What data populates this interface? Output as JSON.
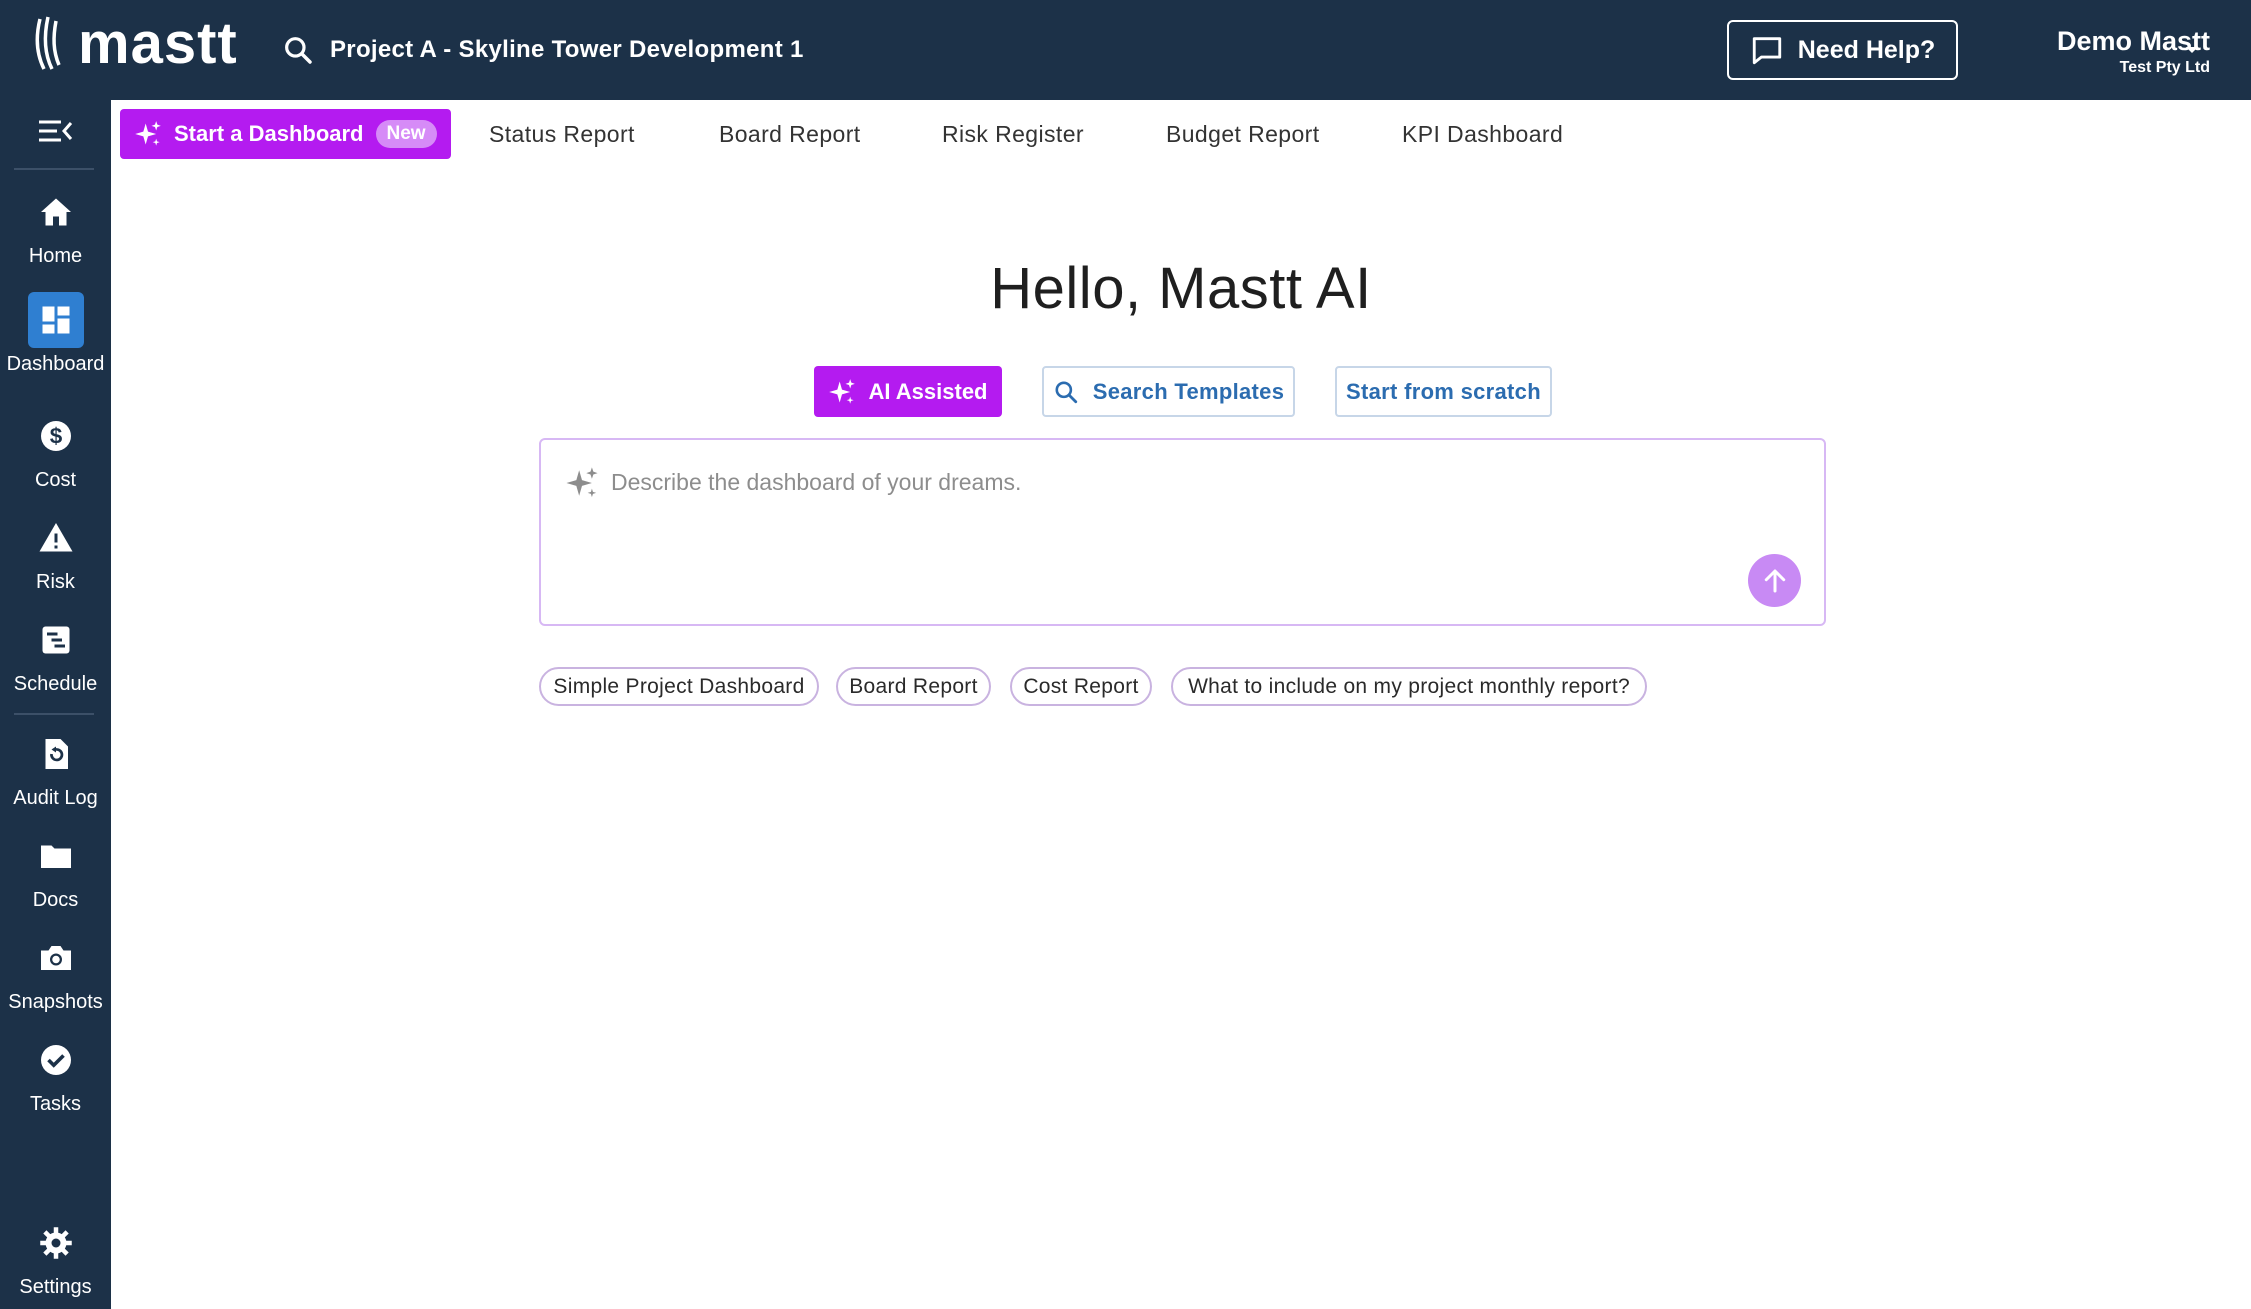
{
  "header": {
    "logo_text": "mastt",
    "project_name": "Project A - Skyline Tower Development 1",
    "help_label": "Need Help?",
    "user_name": "Demo Mastt",
    "user_org": "Test Pty Ltd"
  },
  "sidebar": {
    "items": [
      {
        "label": "Home",
        "icon": "home-icon"
      },
      {
        "label": "Dashboard",
        "icon": "dashboard-icon",
        "active": true
      },
      {
        "label": "Cost",
        "icon": "dollar-icon"
      },
      {
        "label": "Risk",
        "icon": "warning-icon"
      },
      {
        "label": "Schedule",
        "icon": "schedule-icon"
      },
      {
        "label": "Audit Log",
        "icon": "audit-log-icon"
      },
      {
        "label": "Docs",
        "icon": "folder-icon"
      },
      {
        "label": "Snapshots",
        "icon": "camera-icon"
      },
      {
        "label": "Tasks",
        "icon": "check-circle-icon"
      },
      {
        "label": "Settings",
        "icon": "gear-icon"
      }
    ]
  },
  "tabs": {
    "start_label": "Start a Dashboard",
    "new_badge": "New",
    "items": [
      "Status Report",
      "Board Report",
      "Risk Register",
      "Budget Report",
      "KPI Dashboard"
    ]
  },
  "main": {
    "greeting": "Hello, Mastt AI",
    "modes": {
      "ai": "AI Assisted",
      "templates": "Search Templates",
      "scratch": "Start from scratch"
    },
    "prompt_placeholder": "Describe the dashboard of your dreams.",
    "prompt_value": "",
    "suggestions": [
      "Simple Project Dashboard",
      "Board Report",
      "Cost Report",
      "What to include on my project monthly report?"
    ]
  },
  "colors": {
    "navy": "#1c3148",
    "accent_purple": "#b41bf0",
    "active_blue": "#2f7fd1",
    "link_blue": "#2b6cb0"
  }
}
